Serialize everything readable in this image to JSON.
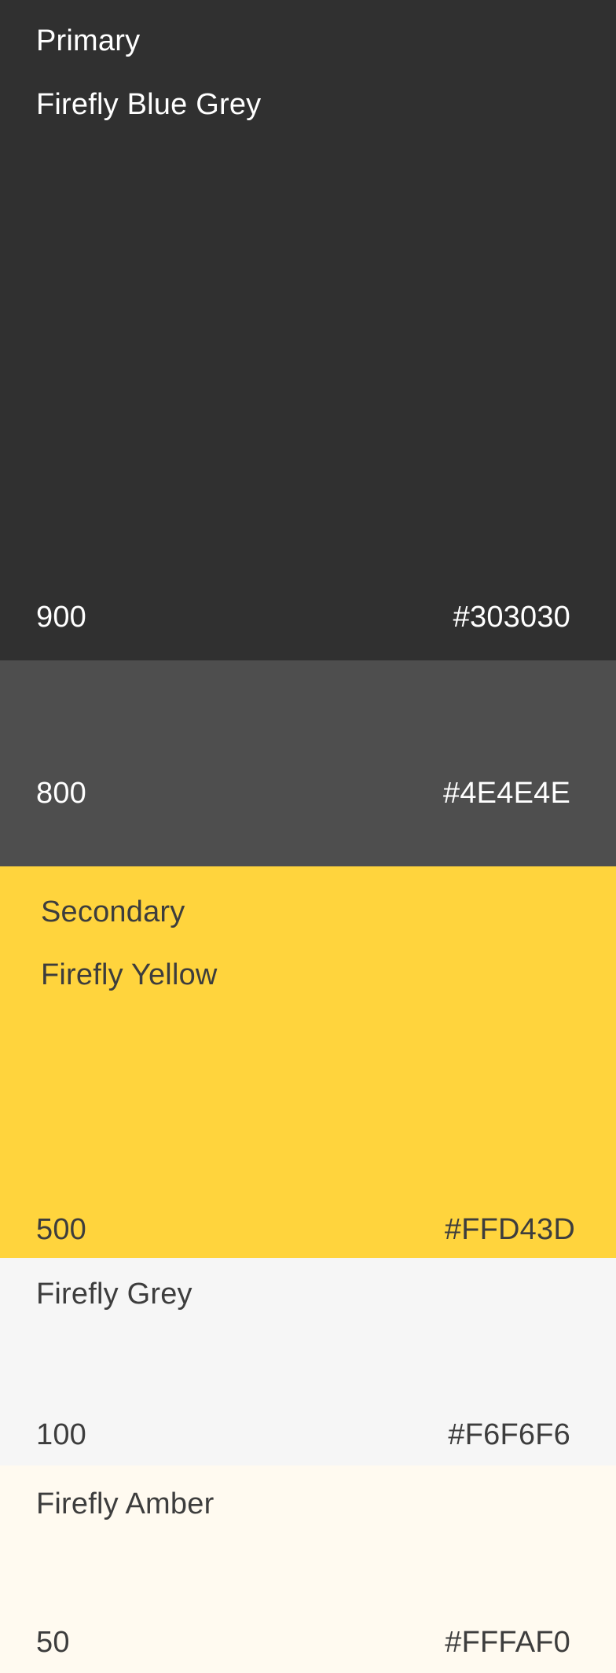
{
  "swatches": [
    {
      "group": "Primary",
      "name": "Firefly Blue Grey",
      "shade": "900",
      "hex": "#303030",
      "color": "#303030"
    },
    {
      "shade": "800",
      "hex": "#4E4E4E",
      "color": "#4E4E4E"
    },
    {
      "group": "Secondary",
      "name": "Firefly Yellow",
      "shade": "500",
      "hex": "#FFD43D",
      "color": "#FFD43D"
    },
    {
      "name": "Firefly Grey",
      "shade": "100",
      "hex": "#F6F6F6",
      "color": "#F6F6F6"
    },
    {
      "name": "Firefly Amber",
      "shade": "50",
      "hex": "#FFFAF0",
      "color": "#FFFAF0"
    }
  ],
  "text_colors": {
    "on_dark": "#FFFFFF",
    "on_light": "#3D3D3D"
  }
}
